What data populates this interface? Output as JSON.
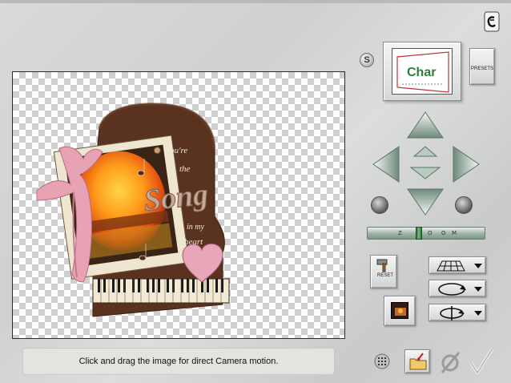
{
  "status": {
    "message": "Click and drag the image for direct Camera motion."
  },
  "presets": {
    "label": "PRESETS"
  },
  "tools": {
    "reset_label": "RESET",
    "s_label": "S"
  },
  "slider": {
    "labels": [
      "Z",
      "O",
      "O",
      "M"
    ]
  },
  "canvas_image": {
    "tagline_line1": "You're",
    "tagline_line2": "the",
    "title_word": "Song",
    "tagline_line3": "in my",
    "tagline_line4": "heart"
  },
  "preview": {
    "thumbnail_text": "Char"
  },
  "colors": {
    "canvas_bg": "#ffffff",
    "status_bg": "#e3e3df",
    "nav_green": "#9fb7a8",
    "accent_check": "#c5c6c7"
  }
}
